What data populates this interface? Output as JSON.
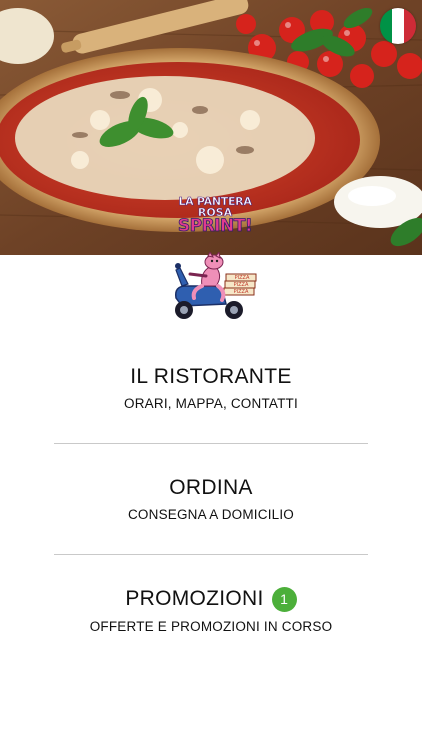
{
  "hero": {
    "logo_line1": "LA PANTERA",
    "logo_line2": "ROSA",
    "logo_line3": "SPRINT!"
  },
  "language": {
    "icon": "italian-flag-icon"
  },
  "mascot": {
    "icon": "pink-panther-scooter-icon",
    "box_text": "PIZZA"
  },
  "menu": [
    {
      "title": "IL RISTORANTE",
      "subtitle": "ORARI, MAPPA, CONTATTI"
    },
    {
      "title": "ORDINA",
      "subtitle": "CONSEGNA A DOMICILIO"
    },
    {
      "title": "PROMOZIONI",
      "subtitle": "OFFERTE E PROMOZIONI IN CORSO",
      "badge": "1"
    }
  ],
  "colors": {
    "badge": "#4caf3a",
    "divider": "#c9c9c9",
    "flag_green": "#009246",
    "flag_red": "#ce2b37"
  }
}
